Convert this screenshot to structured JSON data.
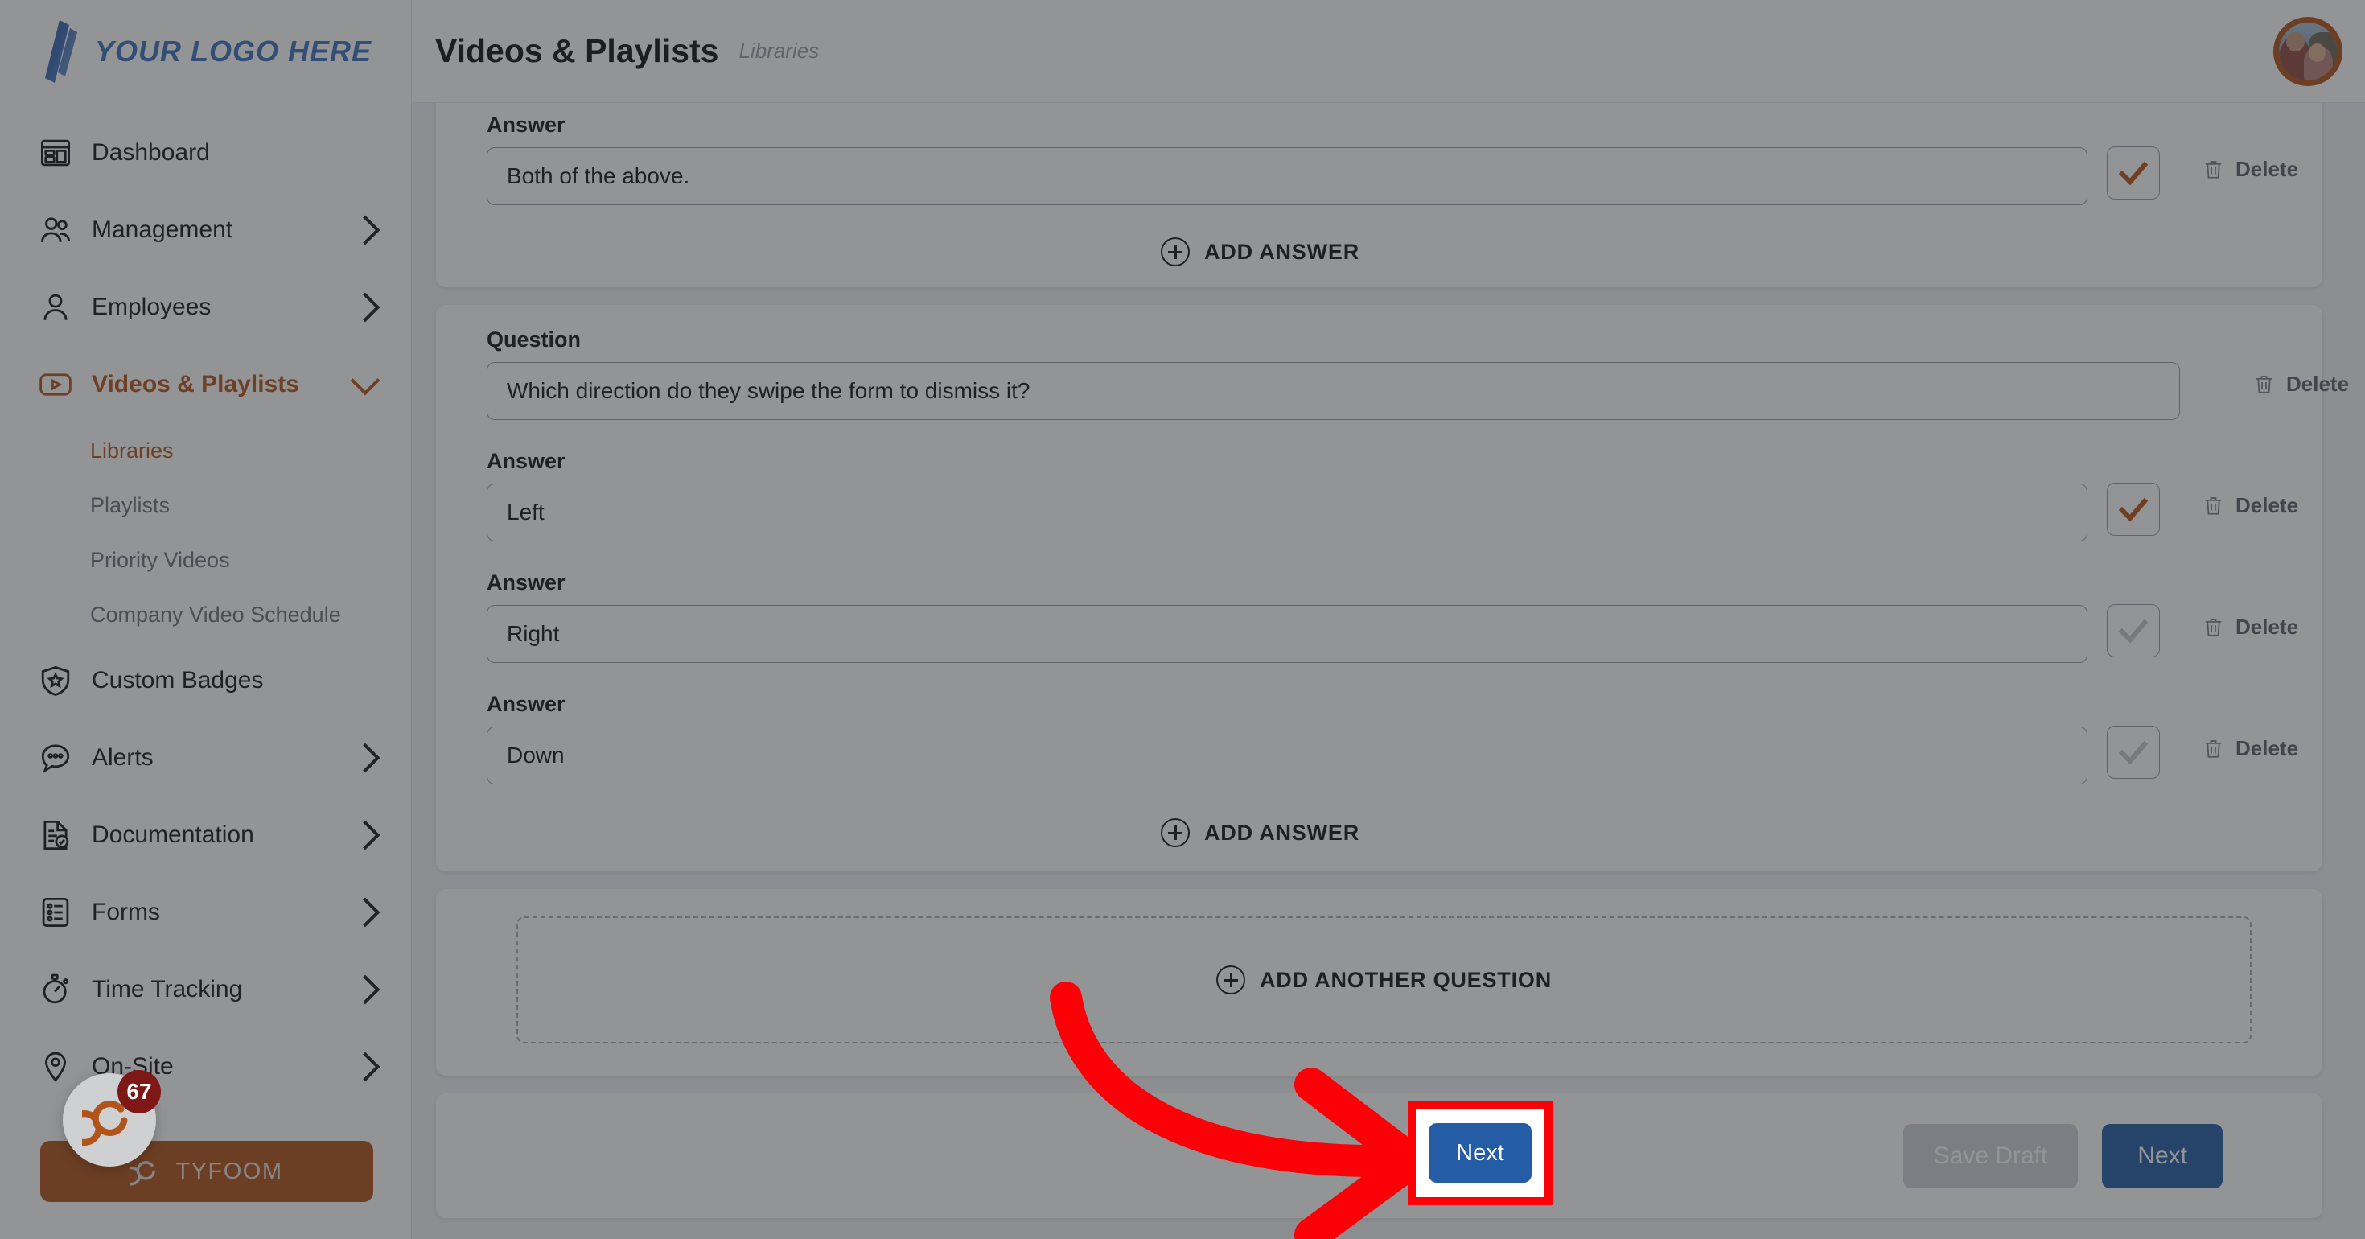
{
  "brand": {
    "logo_text": "YOUR LOGO HERE",
    "accent_color": "#b4541a",
    "logo_color": "#3e72bd",
    "primary_button_color": "#245ca5"
  },
  "sidebar": {
    "items": [
      {
        "label": "Dashboard",
        "icon": "dashboard-icon",
        "has_chevron": false,
        "active": false
      },
      {
        "label": "Management",
        "icon": "people-icon",
        "has_chevron": true,
        "active": false
      },
      {
        "label": "Employees",
        "icon": "person-icon",
        "has_chevron": true,
        "active": false
      },
      {
        "label": "Videos & Playlists",
        "icon": "video-play-icon",
        "has_chevron": true,
        "active": true
      },
      {
        "label": "Custom Badges",
        "icon": "shield-star-icon",
        "has_chevron": false,
        "active": false
      },
      {
        "label": "Alerts",
        "icon": "chat-dots-icon",
        "has_chevron": true,
        "active": false
      },
      {
        "label": "Documentation",
        "icon": "document-check-icon",
        "has_chevron": true,
        "active": false
      },
      {
        "label": "Forms",
        "icon": "form-list-icon",
        "has_chevron": true,
        "active": false
      },
      {
        "label": "Time Tracking",
        "icon": "stopwatch-icon",
        "has_chevron": true,
        "active": false
      },
      {
        "label": "On-Site",
        "icon": "map-pin-icon",
        "has_chevron": true,
        "active": false
      }
    ],
    "sub_items": [
      {
        "label": "Libraries",
        "active": true
      },
      {
        "label": "Playlists",
        "active": false
      },
      {
        "label": "Priority Videos",
        "active": false
      },
      {
        "label": "Company Video Schedule",
        "active": false
      }
    ],
    "tyfoom_pill": {
      "label": "TYFOOM",
      "icon": "spiral-logo-icon"
    },
    "chat_launcher": {
      "badge_count": "67",
      "icon": "spiral-logo-icon"
    }
  },
  "header": {
    "title": "Videos & Playlists",
    "breadcrumb": "Libraries",
    "avatar_alt": "user-avatar"
  },
  "main": {
    "question_cards": [
      {
        "answer_label": "Answer",
        "answers": [
          {
            "label": "Answer",
            "value": "Both of the above.",
            "selected": true,
            "delete_label": "Delete"
          }
        ],
        "add_answer_label": "ADD ANSWER",
        "partial_top": true
      },
      {
        "question_label": "Question",
        "question_value": "Which direction do they swipe the form to dismiss it?",
        "question_delete_label": "Delete",
        "answers": [
          {
            "label": "Answer",
            "value": "Left",
            "selected": true,
            "delete_label": "Delete"
          },
          {
            "label": "Answer",
            "value": "Right",
            "selected": false,
            "delete_label": "Delete"
          },
          {
            "label": "Answer",
            "value": "Down",
            "selected": false,
            "delete_label": "Delete"
          }
        ],
        "add_answer_label": "ADD ANSWER",
        "partial_top": false
      }
    ],
    "add_another_question_label": "ADD ANOTHER QUESTION",
    "footer": {
      "save_draft_label": "Save Draft",
      "next_label": "Next"
    }
  },
  "annotation": {
    "arrow_color": "#fb0007",
    "highlight_border_color": "#fb0007",
    "highlighted_button_label": "Next"
  }
}
